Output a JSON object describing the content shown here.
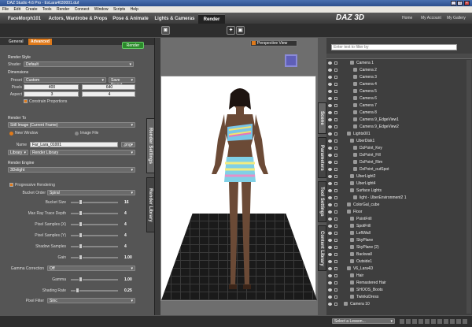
{
  "window": {
    "title": "DAZ Studio 4.6 Pro - ExLara4030001.duf"
  },
  "menu": [
    "File",
    "Edit",
    "Create",
    "Tools",
    "Render",
    "Connect",
    "Window",
    "Scripts",
    "Help"
  ],
  "main_tabs": [
    "FaceMorph101",
    "Actors, Wardrobe & Props",
    "Pose & Animate",
    "Lights & Cameras",
    "Render"
  ],
  "brand": {
    "logo": "DAZ 3D"
  },
  "top_nav": [
    "Home",
    "My Account",
    "My Gallery"
  ],
  "left_panel": {
    "tabs": [
      "General",
      "Advanced"
    ],
    "render_button": "Render",
    "render_style_label": "Render Style",
    "shader_label": "Shader",
    "shader_value": "Default",
    "dimensions_label": "Dimensions",
    "preset_label": "Preset",
    "preset_value": "Custom",
    "save_preset": "Save Preset...",
    "pixels_label": "Pixels",
    "pixels_w": "400",
    "pixels_h": "640",
    "aspect_label": "Aspect",
    "aspect_w": "3",
    "aspect_h": "4",
    "constrain": "Constrain Proportions",
    "render_to_label": "Render To",
    "render_to_value": "Still Image (Current Frame)",
    "new_window": "New Window",
    "image_file": "Image File",
    "name_label": "Name",
    "name_value": "Far_Lara_01001",
    "ext": ".png",
    "library_btn": "Library",
    "library_value": "Render Library",
    "engine_label": "Render Engine",
    "engine_value": "3Delight",
    "progressive": "Progressive Rendering",
    "bucket_order_label": "Bucket Order",
    "bucket_order_value": "Spiral",
    "sliders": [
      {
        "label": "Bucket Size",
        "value": "16"
      },
      {
        "label": "Max Ray Trace Depth",
        "value": "4"
      },
      {
        "label": "Pixel Samples (X)",
        "value": "4"
      },
      {
        "label": "Pixel Samples (Y)",
        "value": "4"
      },
      {
        "label": "Shadow Samples",
        "value": "4"
      },
      {
        "label": "Gain",
        "value": "1.00"
      }
    ],
    "gamma_correction_label": "Gamma Correction",
    "gamma_correction_value": "Off",
    "gamma_label": "Gamma",
    "gamma_value": "1.00",
    "shading_label": "Shading Rate",
    "shading_value": "0.25",
    "pixel_filter_label": "Pixel Filter",
    "pixel_filter_value": "Sinc",
    "side_tabs": [
      "Render Settings",
      "Render Library"
    ]
  },
  "viewport": {
    "camera_menu": "Perspective View"
  },
  "right_panel": {
    "search_placeholder": "Enter text to filter by",
    "side_tabs": [
      "Scene",
      "Parameters",
      "Tool Settings",
      "Content Library"
    ],
    "tree": [
      "Camera 1",
      "Camera 2",
      "Camera 3",
      "Camera 4",
      "Camera 5",
      "Camera 6",
      "Camera 7",
      "Camera 8",
      "Camera 9_EdgeView1",
      "Camera 9_EdgeView2",
      "Lights001",
      "UberDisk1",
      "DzPoint_Key",
      "DzPoint_Fill",
      "DzPoint_Rim",
      "DzPoint_outSpot",
      "UberLight2",
      "UberLight4",
      "Surface Lights",
      "light - UberEnvironment2 1",
      "ColorGal_cube",
      "Floor",
      "PointFrill",
      "SpotFrill",
      "LeftWall",
      "SkyPlane",
      "SkyPlane (2)",
      "Backwall",
      "Outside1",
      "V6_Lara4D",
      "Hair",
      "Remastered Hair",
      "SHOOS_Boots",
      "TwinksDress",
      "Camera 10"
    ],
    "bottom_select": "Select a Lesson..."
  },
  "colors": {
    "accent_orange": "#e07a1a",
    "render_green": "#2a8a2a",
    "panel": "#555555"
  }
}
